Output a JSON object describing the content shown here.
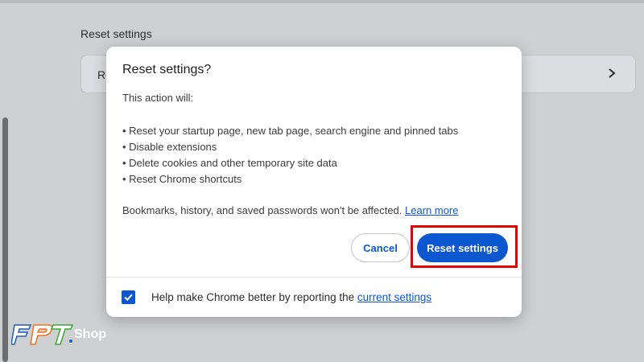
{
  "background": {
    "section_heading": "Reset settings",
    "card_text": "Re",
    "chevron_icon": "chevron-right-icon"
  },
  "dialog": {
    "title": "Reset settings?",
    "intro": "This action will:",
    "items": [
      "• Reset your startup page, new tab page, search engine and pinned tabs",
      "• Disable extensions",
      "• Delete cookies and other temporary site data",
      "• Reset Chrome shortcuts"
    ],
    "note_text": "Bookmarks, history, and saved passwords won't be affected. ",
    "note_link": "Learn more",
    "cancel_label": "Cancel",
    "reset_label": "Reset settings",
    "checkbox_checked": true,
    "checkbox_label": "Help make Chrome better by reporting the ",
    "checkbox_link": "current settings"
  },
  "watermark": {
    "brand": "FPT",
    "shop": "Shop"
  },
  "colors": {
    "accent": "#0b57d0",
    "highlight": "#e00000",
    "logo_blue": "#1f5fb5",
    "logo_orange": "#f37021",
    "logo_green": "#3aa935"
  }
}
